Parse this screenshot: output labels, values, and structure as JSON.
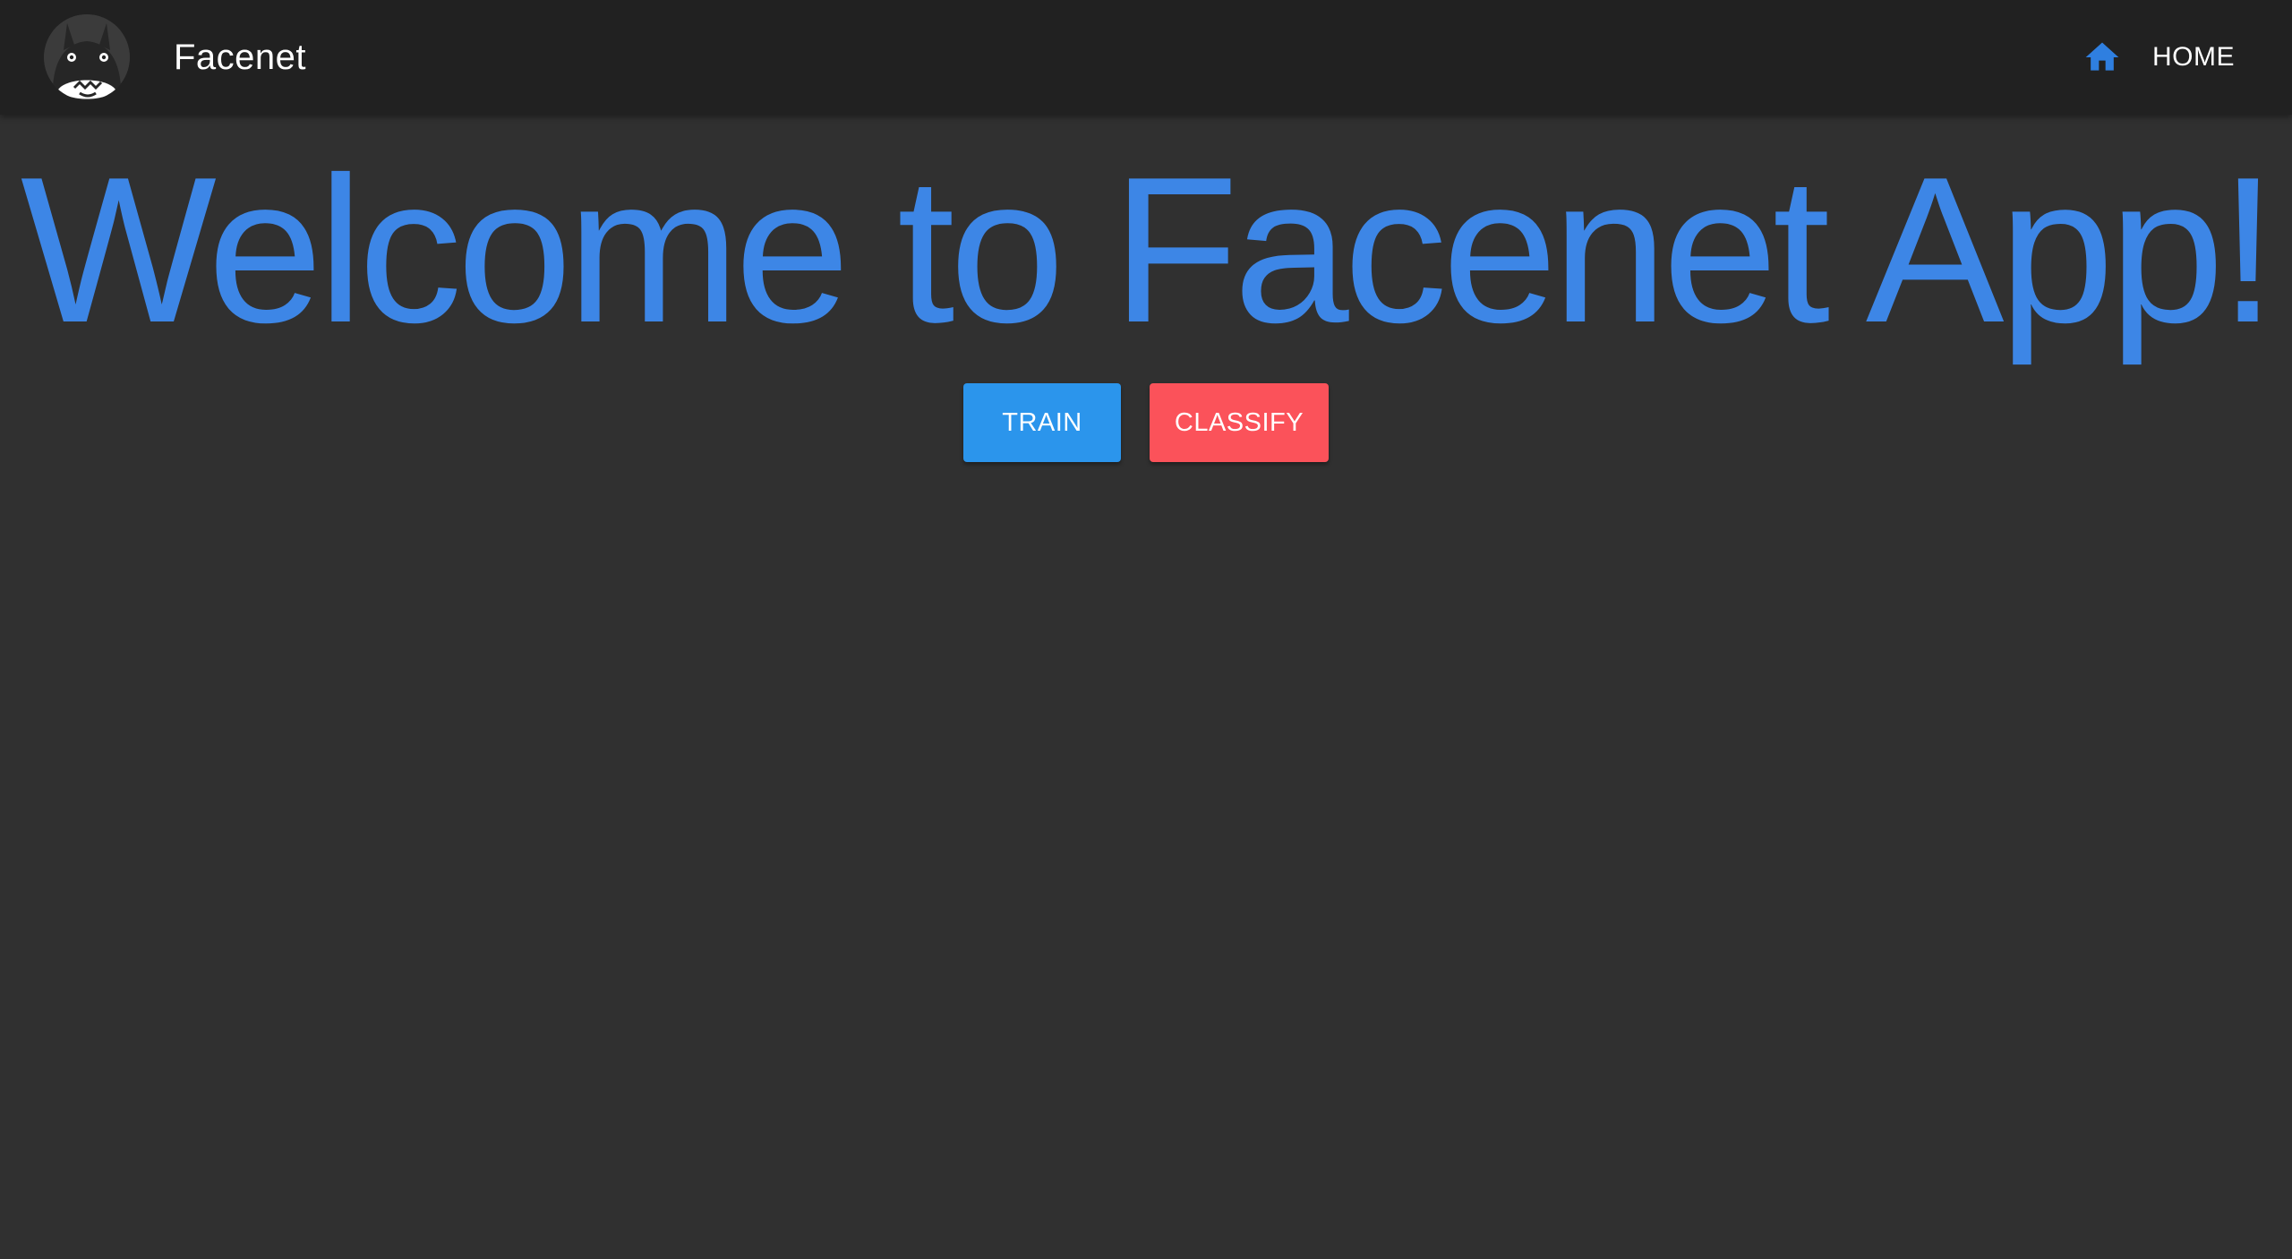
{
  "toolbar": {
    "brand": "Facenet",
    "logo_icon": "totoro-logo-icon",
    "nav": {
      "home_label": "HOME",
      "home_icon": "home-icon"
    }
  },
  "main": {
    "title": "Welcome to Facenet App!",
    "buttons": {
      "train_label": "TRAIN",
      "classify_label": "CLASSIFY"
    }
  },
  "colors": {
    "toolbar_bg": "#212121",
    "page_bg": "#303030",
    "title": "#3d86e6",
    "train_button": "#2b95ec",
    "classify_button": "#fb525a",
    "home_icon": "#2f7fe0"
  }
}
